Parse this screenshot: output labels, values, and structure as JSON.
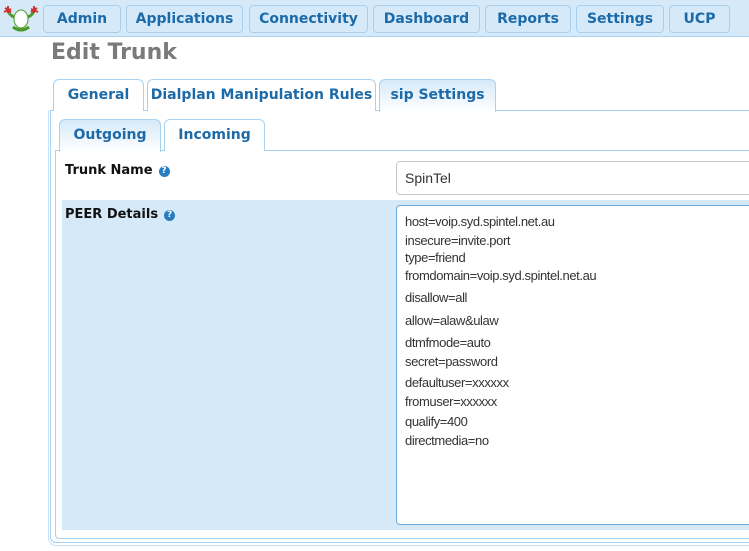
{
  "topnav": {
    "logo_icon": "freepbx-frog-icon",
    "items": [
      {
        "label": "Admin"
      },
      {
        "label": "Applications"
      },
      {
        "label": "Connectivity"
      },
      {
        "label": "Dashboard"
      },
      {
        "label": "Reports"
      },
      {
        "label": "Settings"
      },
      {
        "label": "UCP"
      }
    ]
  },
  "page": {
    "title": "Edit Trunk"
  },
  "main_tabs": [
    {
      "label": "General",
      "active": false
    },
    {
      "label": "Dialplan Manipulation Rules",
      "active": false
    },
    {
      "label": "sip Settings",
      "active": true
    }
  ],
  "sub_tabs": [
    {
      "label": "Outgoing",
      "active": true
    },
    {
      "label": "Incoming",
      "active": false
    }
  ],
  "form": {
    "trunk_name": {
      "label": "Trunk Name",
      "help_icon": "question-circle-icon",
      "value": "SpinTel"
    },
    "peer_details": {
      "label": "PEER Details",
      "help_icon": "question-circle-icon",
      "lines": [
        "host=voip.syd.spintel.net.au",
        "insecure=invite.port",
        "type=friend",
        "fromdomain=voip.syd.spintel.net.au",
        "disallow=all",
        "allow=alaw&ulaw",
        "dtmfmode=auto",
        "secret=password",
        "defaultuser=xxxxxx",
        "fromuser=xxxxxx",
        "qualify=400",
        "directmedia=no"
      ]
    }
  },
  "colors": {
    "accent": "#1d6aa8",
    "nav_bg": "#d6e9f8",
    "border": "#a8d2f0",
    "title_gray": "#7a7a7a"
  }
}
